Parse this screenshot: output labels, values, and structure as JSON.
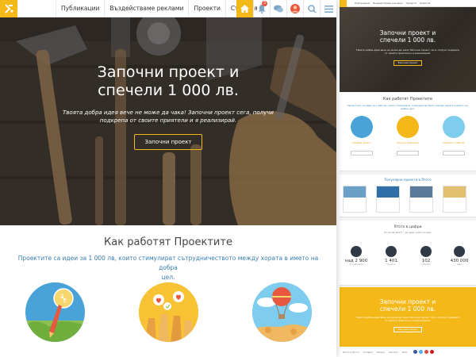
{
  "nav": {
    "links": [
      "Публикации",
      "Въздействаме реклами",
      "Проекти",
      "Събития"
    ],
    "notification_count": "3"
  },
  "hero": {
    "title_line1": "Започни проект и",
    "title_line2": "спечели 1 000 лв.",
    "subtitle_line1": "Твоята добра идея вече не може да чака! Започни проект сега, получи",
    "subtitle_line2": "подкрепа от своите приятели и я реализирай.",
    "button": "Започни проект"
  },
  "how": {
    "title": "Как работят Проектите",
    "text_line1": "Проектите са идеи за 1 000 лв, които стимулират сътрудничеството между хората в името на добра",
    "text_line2": "цел."
  },
  "preview": {
    "hero_title_line1": "Започни проект и",
    "hero_title_line2": "спечели 1 000 лв.",
    "hero_subtitle": "Твоята добра идея вече не може да чака! Започни проект сега, получи подкрепа от своите приятели и я реализирай.",
    "hero_button": "Започни проект",
    "how_title": "Как работят Проектите",
    "how_text": "Проектите са идеи за 1 000 лв, които стимулират сътрудничеството между хората в името на добра цел.",
    "steps": [
      "Създай проект",
      "Получи подкрепа",
      "Спечели 1 000 лв."
    ],
    "popular_title": "Популярни проекти в Ятото",
    "stats_title": "Ятото в цифри",
    "stats_sub": "От 01.01.2013 г. до днес в Ятото има:",
    "stats": [
      {
        "value": "над 2 900",
        "label": "потребители"
      },
      {
        "value": "1 401",
        "label": "проекта"
      },
      {
        "value": "102",
        "label": "събития"
      },
      {
        "value": "430 000",
        "label": "лева"
      }
    ],
    "cta_title_line1": "Започни проект и",
    "cta_title_line2": "спечели 1 000 лв.",
    "cta_subtitle": "Твоята добра идея вече не може да чака! Започни проект сега, получи подкрепа от своите приятели и я реализирай.",
    "cta_button": "Започни проект",
    "footer_links": [
      "Ятото в Ятото",
      "Условия",
      "Помощ",
      "Контакт",
      "Блог",
      "Медии",
      "Партньори"
    ]
  },
  "colors": {
    "brand_yellow": "#f5b819",
    "link_blue": "#3a7fb0",
    "badge_red": "#e8573f"
  },
  "icons": [
    "logo-icon",
    "home-icon",
    "notifications-icon",
    "chat-icon",
    "avatar",
    "search-icon",
    "menu-icon"
  ]
}
